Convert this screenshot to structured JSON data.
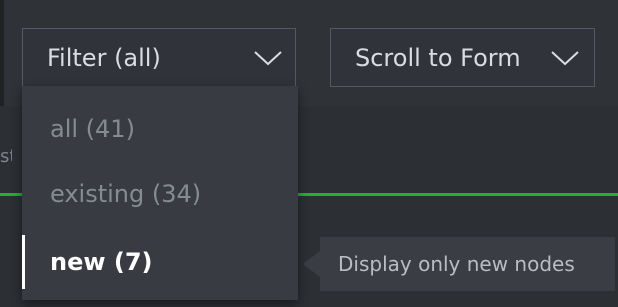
{
  "toolbar": {
    "filter_label": "Filter (all)",
    "filter_icon": "chevron-down-icon",
    "scroll_label": "Scroll to Form",
    "scroll_icon": "chevron-down-icon"
  },
  "filter_menu": {
    "options": [
      {
        "label": "all (41)",
        "selected": false
      },
      {
        "label": "existing (34)",
        "selected": false
      },
      {
        "label": "new (7)",
        "selected": true
      }
    ]
  },
  "tooltip": {
    "text": "Display only new nodes"
  },
  "background": {
    "partial_text": "st"
  },
  "colors": {
    "accent_line": "#1db52d",
    "selected_text": "#ffffff",
    "muted_text": "#868b93"
  }
}
